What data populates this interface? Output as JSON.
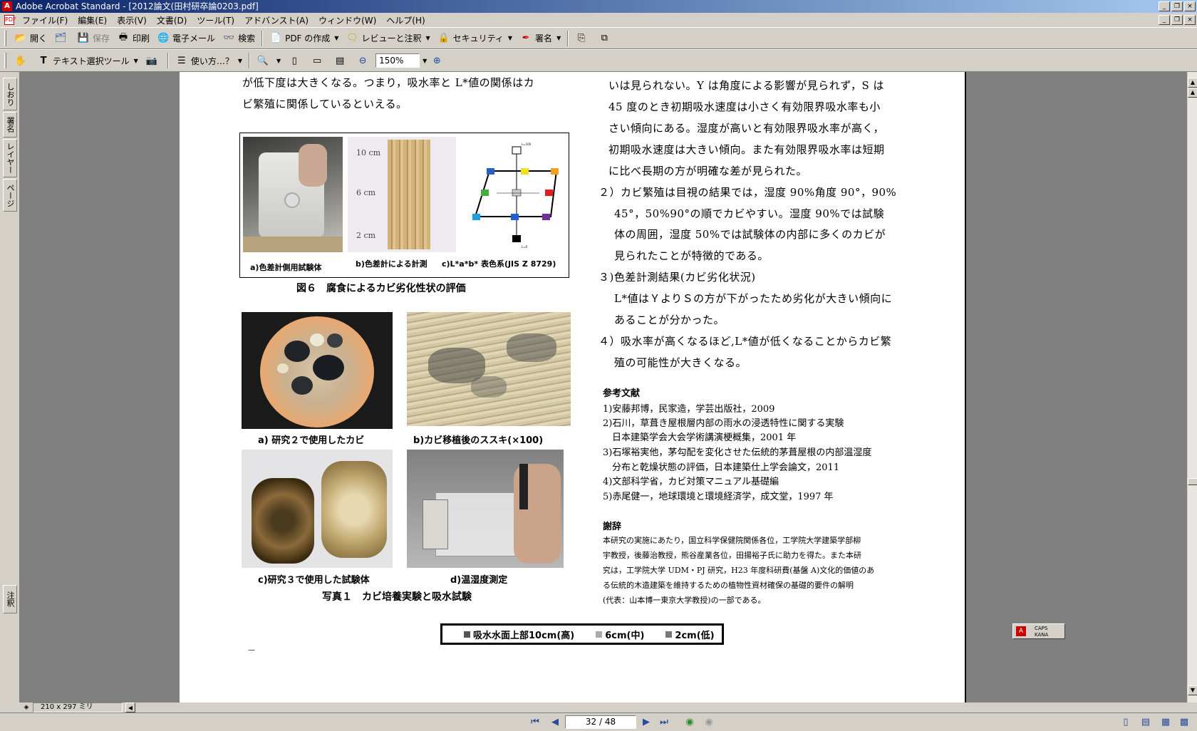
{
  "window": {
    "title": "Adobe Acrobat Standard - [2012論文(田村研卒論0203.pdf]",
    "app_icon": "acrobat-icon",
    "controls": [
      "_",
      "❐",
      "×"
    ]
  },
  "menu": [
    "ファイル(F)",
    "編集(E)",
    "表示(V)",
    "文書(D)",
    "ツール(T)",
    "アドバンスト(A)",
    "ウィンドウ(W)",
    "ヘルプ(H)"
  ],
  "toolbar1": {
    "open": "開く",
    "save": "保存",
    "print": "印刷",
    "email": "電子メール",
    "search": "検索",
    "create_pdf": "PDF の作成",
    "review": "レビューと注釈",
    "security": "セキュリティ",
    "sign": "署名"
  },
  "toolbar2": {
    "text_select": "テキスト選択ツール",
    "howto": "使い方…？",
    "zoom": "150%"
  },
  "left_tabs": [
    "しおり",
    "署名",
    "レイヤー",
    "ページ",
    "注釈"
  ],
  "page": {
    "left_top": [
      "が低下度は大きくなる。つまり，吸水率と L*値の関係はカ",
      "ビ繁殖に関係しているといえる。"
    ],
    "fig6": {
      "caption": "図６　腐食によるカビ劣化性状の評価",
      "a": "a)色差計側用試験体",
      "b": "b)色差計による計測",
      "c": "c)L*a*b* 表色系(JIS Z 8729)",
      "scale": [
        "10 cm",
        "6 cm",
        "2 cm"
      ],
      "diagram_top": "L=100",
      "diagram_bottom": "L=0"
    },
    "photo1": {
      "caption": "写真１　カビ培養実験と吸水試験",
      "a": "a) 研究２で使用したカビ",
      "b": "b)カビ移植後のススキ(×100)",
      "c": "c)研究３で使用した試験体",
      "d": "d)温湿度測定"
    },
    "legend": {
      "items": [
        "吸水水面上部10cm(高)",
        "6cm(中)",
        "2cm(低)"
      ],
      "colors": [
        "#555555",
        "#aaaaaa",
        "#777777"
      ]
    },
    "right_lines": [
      "いは見られない。Y は角度による影響が見られず，S は",
      "45 度のとき初期吸水速度は小さく有効限界吸水率も小",
      "さい傾向にある。湿度が高いと有効限界吸水率が高く，",
      "初期吸水速度は大きい傾向。また有効限界吸水率は短期",
      "に比べ長期の方が明確な差が見られた。"
    ],
    "points": [
      [
        "２）カビ繁殖は目視の結果では，湿度 90%角度 90°，90%",
        "45°，50%90°の順でカビやすい。湿度 90%では試験",
        "体の周囲，湿度 50%では試験体の内部に多くのカビが",
        "見られたことが特徴的である。"
      ],
      [
        "３)色差計測結果(カビ劣化状況)",
        "L*値はＹよりＳの方が下がったため劣化が大きい傾向に",
        "あることが分かった。"
      ],
      [
        "４）吸水率が高くなるほど,L*値が低くなることからカビ繁",
        "殖の可能性が大きくなる。"
      ]
    ],
    "refs_title": "参考文献",
    "refs": [
      "1)安藤邦博，民家造，学芸出版社，2009",
      "2)石川，草葺き屋根層内部の雨水の浸透特性に関する実験",
      "　日本建築学会大会学術講演梗概集，2001 年",
      "3)石塚裕実他，茅勾配を変化させた伝統的茅葺屋根の内部温湿度",
      "　分布と乾燥状態の評価，日本建築仕上学会論文，2011",
      "4)文部科学省，カビ対策マニュアル基礎編",
      "5)赤尾健一，地球環境と環境経済学，成文堂，1997 年"
    ],
    "ack_title": "謝辞",
    "ack": [
      "本研究の実施にあたり，国立科学保健院関係各位，工学院大学建築学部柳",
      "宇教授，後藤治教授，熊谷産業各位，田揚裕子氏に助力を得た。また本研",
      "究は，工学院大学 UDM・PJ 研究，H23 年度科研費(基盤 A)文化的価値のあ",
      "る伝統的木造建築を維持するための植物性資材確保の基礎的要件の解明",
      "(代表：山本博一東京大学教授)の一部である。"
    ],
    "footer_mark": "—"
  },
  "sizebar": "210 x 297 ミリ",
  "status": {
    "page": "32 / 48"
  },
  "ime": {
    "caps": "CAPS",
    "kana": "KANA"
  }
}
